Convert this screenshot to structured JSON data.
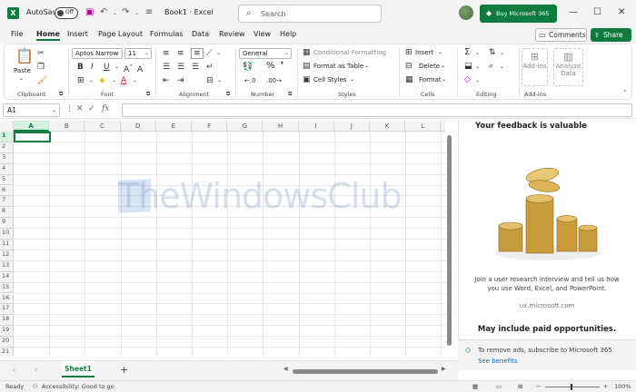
{
  "titlebar": {
    "autosave_label": "AutoSave",
    "autosave_state": "Off",
    "doc_title": "Book1  ·  Excel",
    "search_placeholder": "Search",
    "buy_label": "Buy Microsoft 365"
  },
  "menu": {
    "tabs": [
      "File",
      "Home",
      "Insert",
      "Page Layout",
      "Formulas",
      "Data",
      "Review",
      "View",
      "Help"
    ],
    "active": "Home",
    "comments_label": "Comments",
    "share_label": "Share"
  },
  "ribbon": {
    "clipboard": {
      "label": "Clipboard",
      "paste": "Paste"
    },
    "font": {
      "label": "Font",
      "font_name": "Aptos Narrow",
      "font_size": "11"
    },
    "alignment": {
      "label": "Alignment"
    },
    "number": {
      "label": "Number",
      "format": "General"
    },
    "styles": {
      "label": "Styles",
      "conditional": "Conditional Formatting",
      "format_table": "Format as Table",
      "cell_styles": "Cell Styles"
    },
    "cells": {
      "label": "Cells",
      "insert": "Insert",
      "delete": "Delete",
      "format": "Format"
    },
    "editing": {
      "label": "Editing"
    },
    "addins": {
      "label": "Add-ins",
      "addins_btn": "Add-ins",
      "analyze_line1": "Analyze",
      "analyze_line2": "Data"
    }
  },
  "formula_bar": {
    "name_box": "A1",
    "fx": "fx",
    "value": ""
  },
  "grid": {
    "columns": [
      "A",
      "B",
      "C",
      "D",
      "E",
      "F",
      "G",
      "H",
      "I",
      "J",
      "K",
      "L"
    ],
    "rows": [
      "1",
      "2",
      "3",
      "4",
      "5",
      "6",
      "7",
      "8",
      "9",
      "10",
      "11",
      "12",
      "13",
      "14",
      "15",
      "16",
      "17",
      "18",
      "19",
      "20",
      "21"
    ],
    "selected_cell": "A1"
  },
  "watermark": "TheWindowsClub",
  "side_panel": {
    "heading": "Your feedback is valuable",
    "body": "Join a user research interview and tell us how you use Word, Excel, and PowerPoint.",
    "url": "ux.microsoft.com",
    "paid": "May include paid opportunities.",
    "ad_text": "To remove ads, subscribe to Microsoft 365.",
    "ad_link": "See benefits"
  },
  "sheets": {
    "tabs": [
      "Sheet1"
    ],
    "add": "+"
  },
  "status": {
    "ready": "Ready",
    "accessibility": "Accessibility: Good to go",
    "zoom": "100%"
  }
}
